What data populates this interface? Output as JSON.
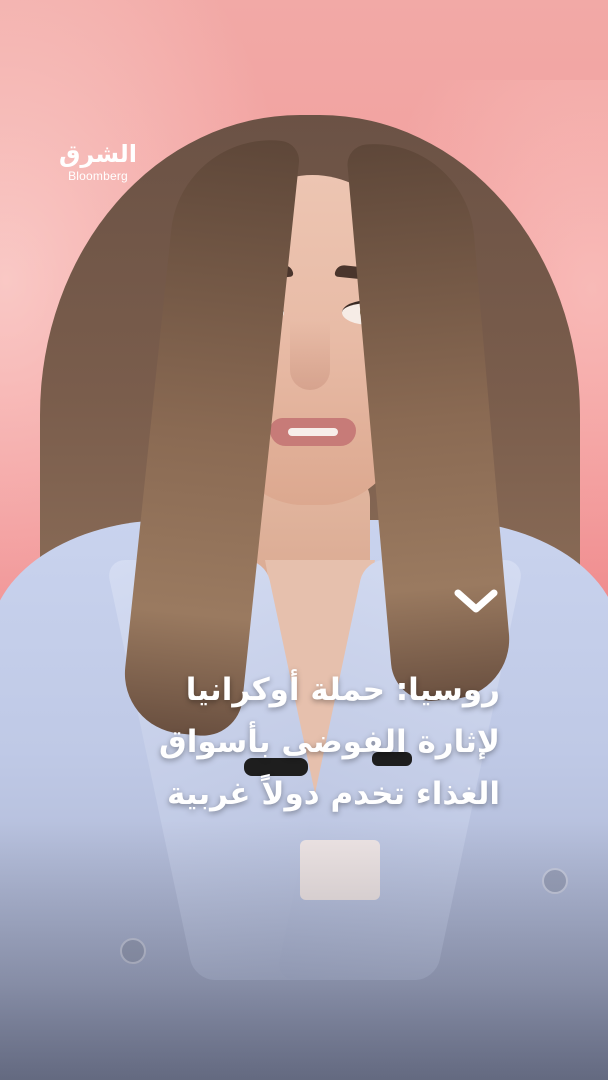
{
  "logo": {
    "arabic": "الشرق",
    "latin": "Bloomberg"
  },
  "icons": {
    "chevron": "chevron-down-icon"
  },
  "headline": {
    "lines": [
      "روسيا: حملة أوكرانيا",
      "لإثارة الفوضى بأسواق",
      "الغذاء تخدم دولاً غربية"
    ]
  },
  "colors": {
    "text": "#ffffff",
    "backdrop": "#f39a9a",
    "jacket": "#c9d3ee"
  }
}
